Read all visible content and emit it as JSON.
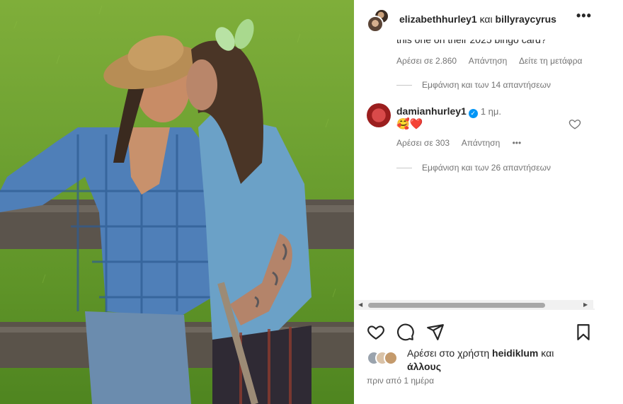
{
  "header": {
    "user1": "elizabethhurley1",
    "conjunction": "και",
    "user2": "billyraycyrus",
    "more_label": "•••"
  },
  "comments": {
    "truncated_text": "this one on their 2025 bingo card?",
    "first_meta": {
      "likes": "Αρέσει σε 2.860",
      "reply": "Απάντηση",
      "translate": "Δείτε τη μετάφρα"
    },
    "first_view_replies": "Εμφάνιση και των 14 απαντήσεων",
    "second": {
      "username": "damianhurley1",
      "verified_glyph": "✓",
      "time": "1 ημ.",
      "emojis": "🥰❤️",
      "likes": "Αρέσει σε 303",
      "reply": "Απάντηση",
      "more": "•••",
      "view_replies": "Εμφάνιση και των 26 απαντήσεων"
    }
  },
  "scrollbar": {
    "left_arrow": "◀",
    "right_arrow": "▶"
  },
  "actions": [
    "heart-icon",
    "comment-icon",
    "share-icon",
    "bookmark-icon"
  ],
  "likes": {
    "prefix": "Αρέσει στο χρήστη ",
    "user": "heidiklum",
    "suffix_and": " και",
    "others": "άλλους"
  },
  "timestamp": "πριν από 1 ημέρα",
  "colors": {
    "verified": "#0095f6",
    "heart_emoji": "#ed4956",
    "muted": "#737373"
  }
}
